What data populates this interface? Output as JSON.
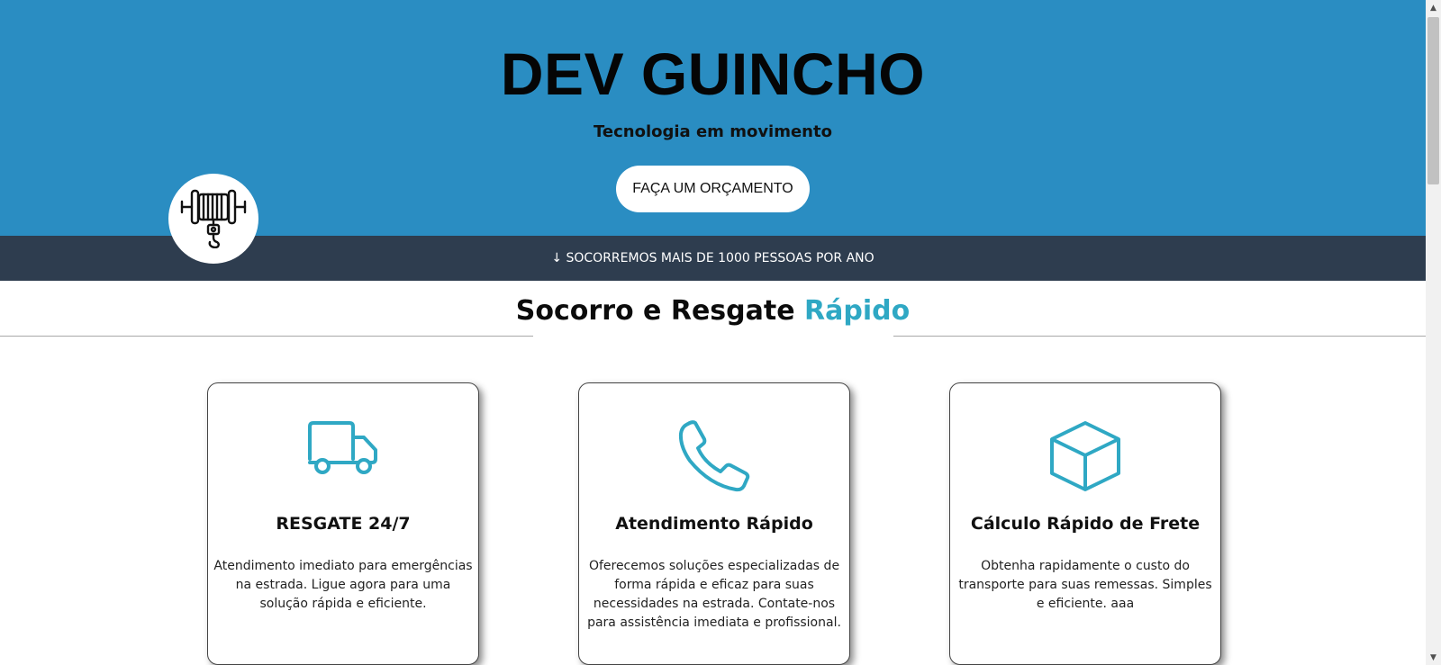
{
  "hero": {
    "title": "DEV GUINCHO",
    "tagline": "Tecnologia em movimento",
    "cta_label": "FAÇA UM ORÇAMENTO",
    "background_color": "#2a8dc2",
    "logo_icon": "tow-winch-hook-icon"
  },
  "stats": {
    "text": "↓ SOCORREMOS MAIS DE 1000 PESSOAS POR ANO",
    "background_color": "#2e3d4f"
  },
  "section": {
    "title_main": "Socorro e Resgate ",
    "title_accent": "Rápido",
    "accent_color": "#2fa8c4"
  },
  "cards": [
    {
      "icon": "truck-icon",
      "title": "RESGATE 24/7",
      "text": "Atendimento imediato para emergências na estrada. Ligue agora para uma solução rápida e eficiente."
    },
    {
      "icon": "phone-icon",
      "title": "Atendimento Rápido",
      "text": "Oferecemos soluções especializadas de forma rápida e eficaz para suas necessidades na estrada. Contate-nos para assistência imediata e profissional."
    },
    {
      "icon": "box-icon",
      "title": "Cálculo Rápido de Frete",
      "text": "Obtenha rapidamente o custo do transporte para suas remessas. Simples e eficiente. aaa"
    }
  ]
}
